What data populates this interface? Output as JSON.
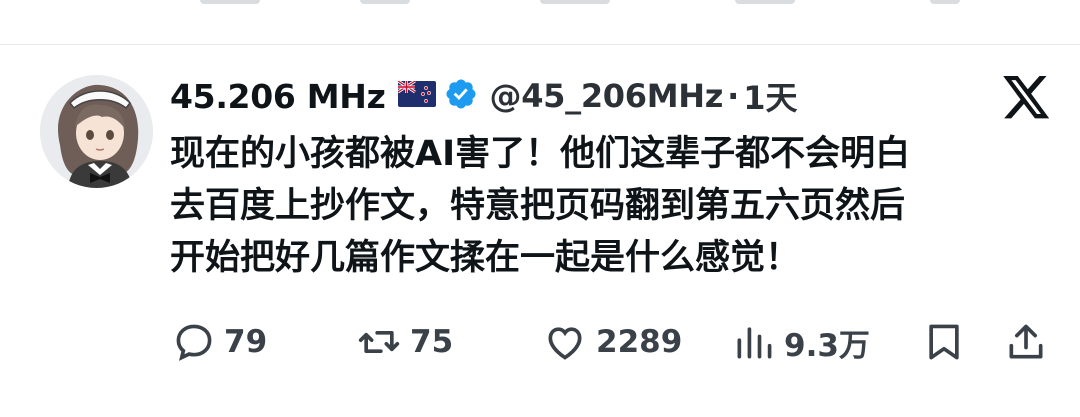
{
  "tweet": {
    "display_name": "45.206 MHz",
    "handle": "@45_206MHz",
    "separator": "·",
    "time": "1天",
    "body_lines": [
      "现在的小孩都被AI害了！他们这辈子都不会明白",
      "去百度上抄作文，特意把页码翻到第五六页然后",
      "开始把好几篇作文揉在一起是什么感觉！"
    ],
    "stats": {
      "replies": "79",
      "reposts": "75",
      "likes": "2289",
      "views": "9.3万"
    }
  },
  "icons": {
    "flag": "new-zealand-flag-icon",
    "verified": "verified-badge-icon",
    "platform": "x-logo-icon",
    "reply": "reply-bubble-icon",
    "repost": "repost-arrows-icon",
    "like": "heart-icon",
    "views": "views-bar-chart-icon",
    "bookmark": "bookmark-icon",
    "share": "share-upload-icon"
  },
  "colors": {
    "text": "#0f1419",
    "secondary": "#2b3137",
    "verified": "#1d9bf0",
    "divider": "#e6e9ec"
  }
}
